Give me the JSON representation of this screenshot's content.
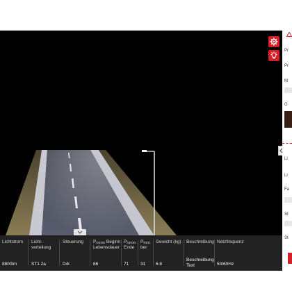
{
  "icons": {
    "settings": "gear-icon",
    "light": "bulb-icon",
    "collapse": "chevron-down-icon",
    "panel_toggle": "chevron-left-icon",
    "panel_header": "warning-icon"
  },
  "colors": {
    "accent": "#d51f26",
    "spec_bar_bg": "#222222",
    "viewport_bg": "#000000"
  },
  "spec_table": {
    "columns": [
      {
        "key": "lichtstrom",
        "header": "Lichtstrom",
        "value": "8800lm"
      },
      {
        "key": "lichtverteilung",
        "header": "Licht-verteilung",
        "value": "ST1.2a"
      },
      {
        "key": "steuerung",
        "header": "Steuerung",
        "value": "D4i"
      },
      {
        "key": "pnenn_beginn",
        "header_main": "P",
        "header_sub": "NENN",
        "header_rest": " Beginn Lebensdauer",
        "value": "66"
      },
      {
        "key": "pnenn_ende",
        "header_main": "P",
        "header_sub": "NENN",
        "header_rest": " Ende",
        "value": "71"
      },
      {
        "key": "pred_ber",
        "header_main": "P",
        "header_sub": "RED.",
        "header_rest": " ber",
        "value": "31"
      },
      {
        "key": "gewicht",
        "header": "Gewicht (kg)",
        "value": "6.8"
      },
      {
        "key": "beschreibung",
        "header": "Beschreibung",
        "value": "Beschreibung Text"
      },
      {
        "key": "netzfrequenz",
        "header": "Netzfrequenz",
        "value": "50/60Hz"
      }
    ]
  },
  "right_panel": {
    "labels": [
      "Pr",
      "Pr",
      "M",
      "G",
      "Li",
      "Li",
      "Fa",
      "St",
      "St"
    ]
  }
}
